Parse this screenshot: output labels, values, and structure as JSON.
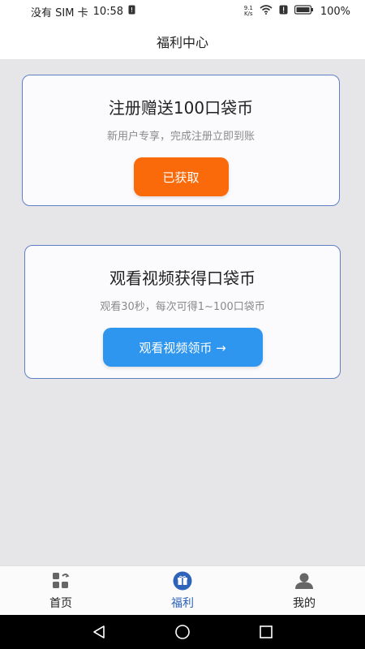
{
  "status_bar": {
    "carrier": "没有 SIM 卡",
    "time": "10:58",
    "net_speed_value": "9.1",
    "net_speed_unit": "K/s",
    "battery": "100%",
    "icons": [
      "alert-icon",
      "wifi-icon",
      "notification-icon",
      "battery-icon"
    ]
  },
  "header": {
    "title": "福利中心"
  },
  "cards": [
    {
      "title": "注册赠送100口袋币",
      "desc": "新用户专享，完成注册立即到账",
      "button": "已获取"
    },
    {
      "title": "观看视频获得口袋币",
      "desc": "观看30秒，每次可得1~100口袋币",
      "button": "观看视频领币 →"
    }
  ],
  "tabs": [
    {
      "label": "首页",
      "icon": "home-grid-icon",
      "active": false
    },
    {
      "label": "福利",
      "icon": "gift-icon",
      "active": true
    },
    {
      "label": "我的",
      "icon": "profile-icon",
      "active": false
    }
  ],
  "colors": {
    "accent": "#2d63b8",
    "orange_button": "#fa6a0a",
    "blue_button": "#2f96ef",
    "card_border": "#5f80c7"
  }
}
